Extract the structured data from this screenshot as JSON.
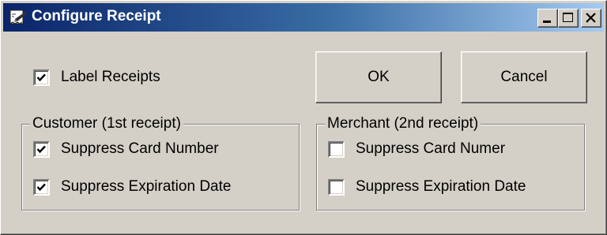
{
  "window": {
    "title": "Configure Receipt",
    "icon": "receipt-app-icon",
    "controls": {
      "minimize": "minimize-icon",
      "maximize": "maximize-icon",
      "close": "close-icon"
    }
  },
  "label_receipts": {
    "label": "Label Receipts",
    "checked": true
  },
  "buttons": {
    "ok_label": "OK",
    "cancel_label": "Cancel"
  },
  "customer_group": {
    "title": "Customer (1st receipt)",
    "items": [
      {
        "label": "Suppress Card Number",
        "checked": true
      },
      {
        "label": "Suppress Expiration Date",
        "checked": true
      }
    ]
  },
  "merchant_group": {
    "title": "Merchant (2nd receipt)",
    "items": [
      {
        "label": "Suppress Card Numer",
        "checked": false
      },
      {
        "label": "Suppress Expiration Date",
        "checked": false
      }
    ]
  }
}
